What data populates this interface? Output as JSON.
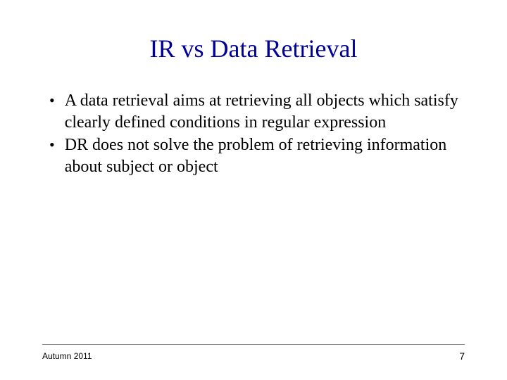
{
  "slide": {
    "title": "IR vs Data Retrieval",
    "bullets": [
      "A data retrieval aims at retrieving all objects which satisfy clearly defined conditions in regular expression",
      "DR does not solve the problem of retrieving information about subject or object"
    ],
    "footer": {
      "left": "Autumn  2011",
      "page": "7"
    }
  }
}
